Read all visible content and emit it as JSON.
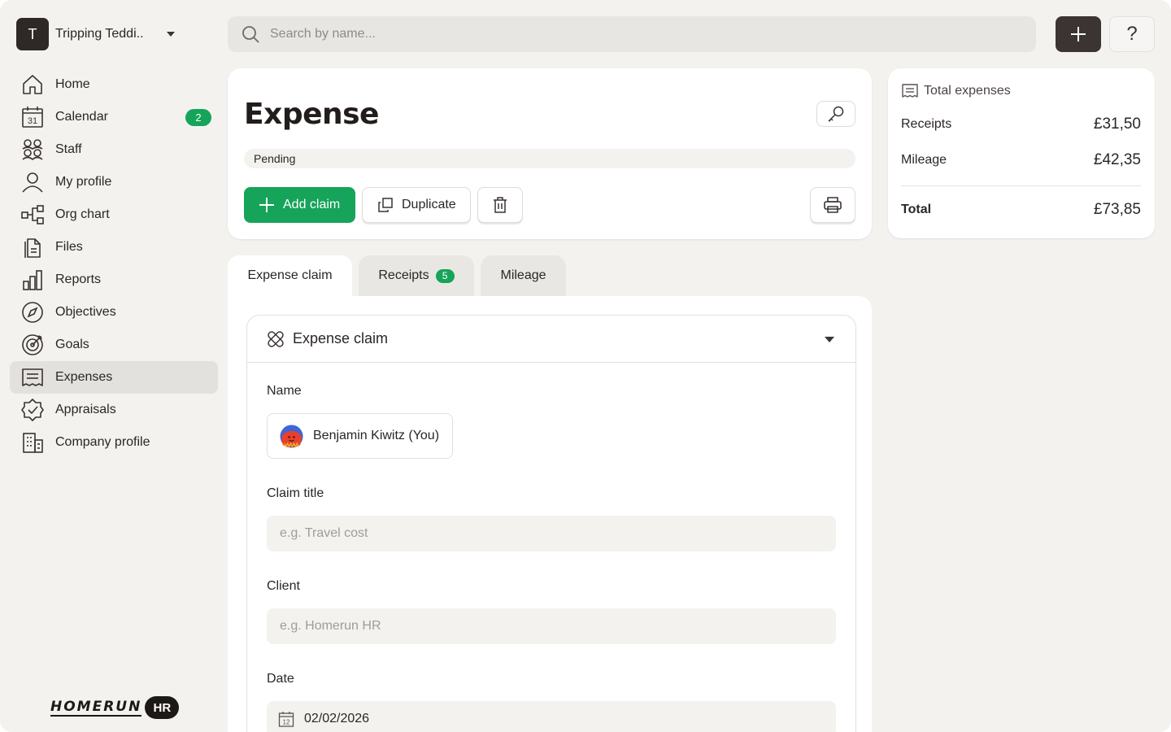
{
  "sidebar": {
    "org": {
      "initial": "T",
      "name": "Tripping Teddi.."
    },
    "items": [
      {
        "label": "Home",
        "icon": "home-icon"
      },
      {
        "label": "Calendar",
        "icon": "calendar-icon",
        "badge": "2",
        "icon_text": "31"
      },
      {
        "label": "Staff",
        "icon": "staff-icon"
      },
      {
        "label": "My profile",
        "icon": "user-icon"
      },
      {
        "label": "Org chart",
        "icon": "org-chart-icon"
      },
      {
        "label": "Files",
        "icon": "files-icon"
      },
      {
        "label": "Reports",
        "icon": "bar-chart-icon"
      },
      {
        "label": "Objectives",
        "icon": "compass-icon"
      },
      {
        "label": "Goals",
        "icon": "target-icon"
      },
      {
        "label": "Expenses",
        "icon": "receipt-icon",
        "active": true
      },
      {
        "label": "Appraisals",
        "icon": "badge-check-icon"
      },
      {
        "label": "Company profile",
        "icon": "building-icon"
      }
    ],
    "logo": {
      "word": "HOMERUN",
      "suffix": "HR"
    }
  },
  "topbar": {
    "search_placeholder": "Search by name...",
    "help_label": "?"
  },
  "header": {
    "title": "Expense",
    "status": "Pending",
    "add_claim_label": "Add claim",
    "duplicate_label": "Duplicate"
  },
  "totals": {
    "heading": "Total expenses",
    "receipts_label": "Receipts",
    "receipts_value": "£31,50",
    "mileage_label": "Mileage",
    "mileage_value": "£42,35",
    "total_label": "Total",
    "total_value": "£73,85"
  },
  "tabs": [
    {
      "label": "Expense claim",
      "active": true
    },
    {
      "label": "Receipts",
      "badge": "5"
    },
    {
      "label": "Mileage"
    }
  ],
  "form": {
    "section_title": "Expense claim",
    "name_label": "Name",
    "person_name": "Benjamin Kiwitz (You)",
    "claim_title_label": "Claim title",
    "claim_title_placeholder": "e.g. Travel cost",
    "client_label": "Client",
    "client_placeholder": "e.g. Homerun HR",
    "date_label": "Date",
    "date_value": "02/02/2026",
    "date_icon_text": "12"
  },
  "colors": {
    "accent_green": "#16a35a",
    "dark_button": "#3b3432",
    "background": "#f3f2ef"
  }
}
